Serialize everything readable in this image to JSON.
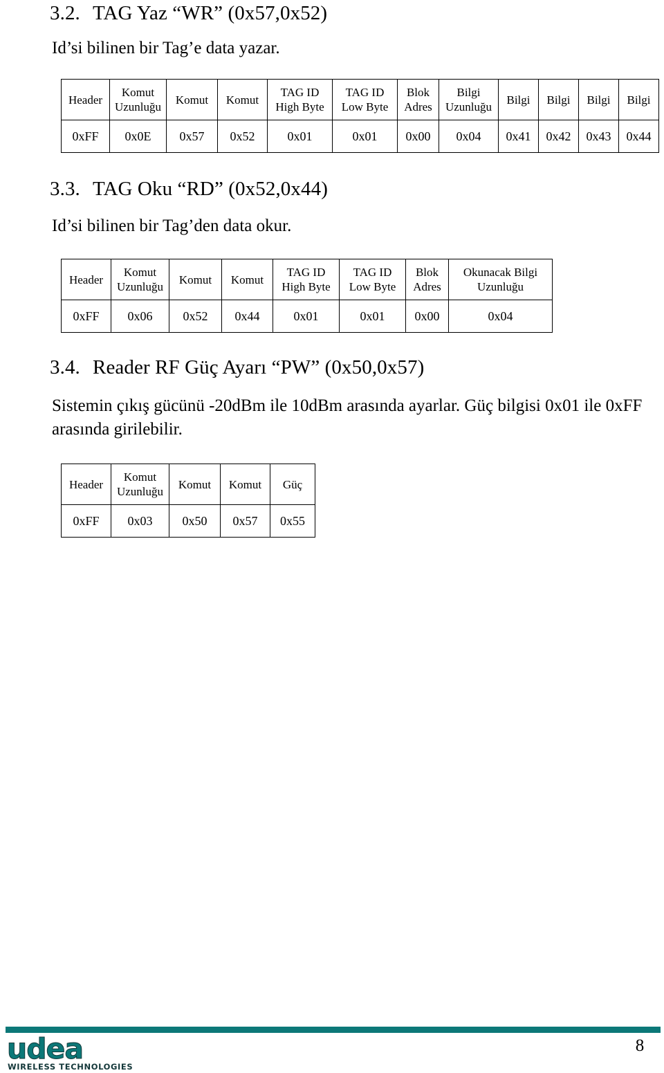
{
  "document": {
    "page_number": "8",
    "brand": {
      "wordmark": "udea",
      "tagline": "WIRELESS TECHNOLOGIES",
      "accent_color": "#0c7878"
    }
  },
  "sections": [
    {
      "number": "3.2.",
      "title": "TAG Yaz “WR” (0x57,0x52)",
      "body": "Id’si bilinen bir Tag’e data yazar.",
      "table": {
        "headers": [
          {
            "line1": "Header",
            "line2": ""
          },
          {
            "line1": "Komut",
            "line2": "Uzunluğu"
          },
          {
            "line1": "Komut",
            "line2": ""
          },
          {
            "line1": "Komut",
            "line2": ""
          },
          {
            "line1": "TAG ID",
            "line2": "High Byte"
          },
          {
            "line1": "TAG ID",
            "line2": "Low Byte"
          },
          {
            "line1": "Blok",
            "line2": "Adres"
          },
          {
            "line1": "Bilgi",
            "line2": "Uzunluğu"
          },
          {
            "line1": "Bilgi",
            "line2": ""
          },
          {
            "line1": "Bilgi",
            "line2": ""
          },
          {
            "line1": "Bilgi",
            "line2": ""
          },
          {
            "line1": "Bilgi",
            "line2": ""
          }
        ],
        "values": [
          "0xFF",
          "0x0E",
          "0x57",
          "0x52",
          "0x01",
          "0x01",
          "0x00",
          "0x04",
          "0x41",
          "0x42",
          "0x43",
          "0x44"
        ]
      }
    },
    {
      "number": "3.3.",
      "title": "TAG Oku “RD” (0x52,0x44)",
      "body": "Id’si bilinen bir Tag’den data okur.",
      "table": {
        "headers": [
          {
            "line1": "Header",
            "line2": ""
          },
          {
            "line1": "Komut",
            "line2": "Uzunluğu"
          },
          {
            "line1": "Komut",
            "line2": ""
          },
          {
            "line1": "Komut",
            "line2": ""
          },
          {
            "line1": "TAG ID",
            "line2": "High Byte"
          },
          {
            "line1": "TAG ID",
            "line2": "Low Byte"
          },
          {
            "line1": "Blok",
            "line2": "Adres"
          },
          {
            "line1": "Okunacak Bilgi",
            "line2": "Uzunluğu"
          }
        ],
        "values": [
          "0xFF",
          "0x06",
          "0x52",
          "0x44",
          "0x01",
          "0x01",
          "0x00",
          "0x04"
        ]
      }
    },
    {
      "number": "3.4.",
      "title": "Reader RF Güç Ayarı “PW” (0x50,0x57)",
      "body": "Sistemin çıkış gücünü -20dBm ile 10dBm arasında ayarlar. Güç bilgisi 0x01 ile 0xFF arasında girilebilir.",
      "table": {
        "headers": [
          {
            "line1": "Header",
            "line2": ""
          },
          {
            "line1": "Komut",
            "line2": "Uzunluğu"
          },
          {
            "line1": "Komut",
            "line2": ""
          },
          {
            "line1": "Komut",
            "line2": ""
          },
          {
            "line1": "Güç",
            "line2": ""
          }
        ],
        "values": [
          "0xFF",
          "0x03",
          "0x50",
          "0x57",
          "0x55"
        ]
      }
    }
  ]
}
